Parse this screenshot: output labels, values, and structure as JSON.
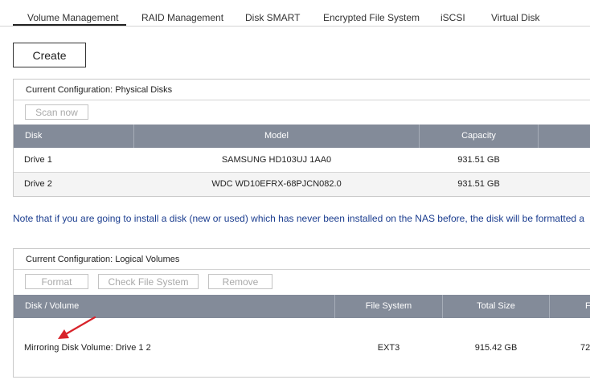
{
  "tabs": [
    {
      "label": "Volume Management",
      "active": true
    },
    {
      "label": "RAID Management",
      "active": false
    },
    {
      "label": "Disk SMART",
      "active": false
    },
    {
      "label": "Encrypted File System",
      "active": false
    },
    {
      "label": "iSCSI",
      "active": false
    },
    {
      "label": "Virtual Disk",
      "active": false
    }
  ],
  "toolbar": {
    "create_label": "Create"
  },
  "physical": {
    "title": "Current Configuration: Physical Disks",
    "scan_label": "Scan now",
    "columns": [
      "Disk",
      "Model",
      "Capacity"
    ],
    "rows": [
      {
        "disk": "Drive 1",
        "model": "SAMSUNG HD103UJ 1AA0",
        "capacity": "931.51 GB"
      },
      {
        "disk": "Drive 2",
        "model": "WDC WD10EFRX-68PJCN082.0",
        "capacity": "931.51 GB"
      }
    ]
  },
  "note": "Note that if you are going to install a disk (new or used) which has never been installed on the NAS before, the disk will be formatted a",
  "logical": {
    "title": "Current Configuration: Logical Volumes",
    "buttons": {
      "format": "Format",
      "check": "Check File System",
      "remove": "Remove"
    },
    "columns": [
      "Disk / Volume",
      "File System",
      "Total Size",
      "F"
    ],
    "rows": [
      {
        "volume": "Mirroring Disk Volume: Drive 1 2",
        "fs": "EXT3",
        "total": "915.42 GB",
        "free": "72"
      }
    ]
  },
  "colors": {
    "header_bg": "#838b99",
    "note_text": "#1b3d8f",
    "arrow": "#d8232a",
    "row_alt": "#f4f4f4"
  }
}
